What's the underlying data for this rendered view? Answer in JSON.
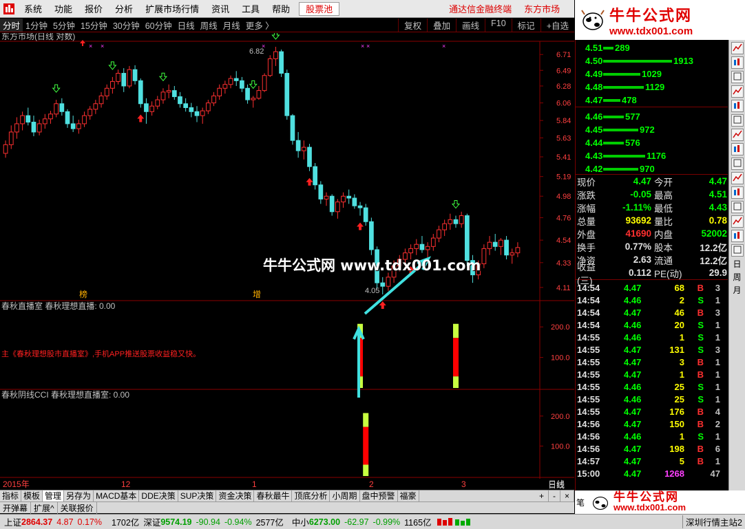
{
  "menu": {
    "items": [
      "系统",
      "功能",
      "报价",
      "分析",
      "扩展市场行情",
      "资讯",
      "工具",
      "帮助"
    ],
    "stock_pool": "股票池",
    "promo1": "通达信金融终端",
    "promo2": "东方市场"
  },
  "period_bar": {
    "periods": [
      "分时",
      "1分钟",
      "5分钟",
      "15分钟",
      "30分钟",
      "60分钟",
      "日线",
      "周线",
      "月线",
      "更多 〉"
    ],
    "active": "分时",
    "right_buttons": [
      "复权",
      "叠加",
      "画线",
      "F10",
      "标记",
      "+自选"
    ]
  },
  "chart": {
    "title": "东方市场(日线 对数)",
    "price_ticks": [
      "6.71",
      "6.49",
      "6.28",
      "6.06",
      "5.84",
      "5.63",
      "5.41",
      "5.19",
      "4.98",
      "4.76",
      "4.54",
      "4.33",
      "4.11"
    ],
    "high_label": "6.82",
    "low_label": "4.05",
    "tag1": "榜",
    "tag2": "增",
    "indicator1_title": "春秋直播室 春秋理想直播: 0.00",
    "indicator1_ticks": [
      "200.0",
      "100.0"
    ],
    "indicator1_text": "主《春秋理想股市直播室》,手机APP推送股票收益稳又快。",
    "indicator2_title": "春秋阴线CCI 春秋理想直播室: 0.00",
    "indicator2_ticks": [
      "200.0",
      "100.0"
    ],
    "date_labels": [
      "2015年",
      "12",
      "1",
      "2",
      "3"
    ],
    "period_label": "日线",
    "watermark": "牛牛公式网 www.tdx001.com"
  },
  "chart_data": {
    "type": "candlestick",
    "title": "东方市场(日线 对数)",
    "ylim": [
      4.05,
      6.82
    ],
    "ohlc": [
      [
        5.45,
        5.6,
        5.4,
        5.55
      ],
      [
        5.55,
        5.78,
        5.5,
        5.7
      ],
      [
        5.7,
        5.88,
        5.62,
        5.8
      ],
      [
        5.8,
        5.95,
        5.72,
        5.9
      ],
      [
        5.9,
        6.0,
        5.78,
        5.82
      ],
      [
        5.82,
        5.9,
        5.65,
        5.7
      ],
      [
        5.7,
        5.85,
        5.66,
        5.8
      ],
      [
        5.8,
        5.92,
        5.74,
        5.86
      ],
      [
        5.86,
        5.96,
        5.8,
        5.92
      ],
      [
        5.92,
        6.1,
        5.88,
        6.05
      ],
      [
        6.05,
        6.12,
        5.9,
        5.95
      ],
      [
        5.95,
        5.98,
        5.75,
        5.8
      ],
      [
        5.8,
        5.9,
        5.7,
        5.74
      ],
      [
        5.74,
        5.85,
        5.68,
        5.8
      ],
      [
        5.8,
        5.95,
        5.76,
        5.9
      ],
      [
        5.9,
        6.02,
        5.85,
        5.98
      ],
      [
        5.98,
        6.1,
        5.92,
        6.05
      ],
      [
        6.05,
        6.2,
        6.0,
        6.15
      ],
      [
        6.15,
        6.3,
        6.1,
        6.25
      ],
      [
        6.25,
        6.4,
        6.18,
        6.34
      ],
      [
        6.34,
        6.5,
        6.3,
        6.45
      ],
      [
        6.45,
        6.52,
        6.2,
        6.28
      ],
      [
        6.28,
        6.55,
        6.25,
        6.5
      ],
      [
        6.5,
        6.56,
        6.3,
        6.35
      ],
      [
        6.35,
        6.38,
        6.0,
        6.05
      ],
      [
        6.05,
        6.12,
        5.8,
        5.95
      ],
      [
        5.95,
        6.08,
        5.9,
        6.02
      ],
      [
        6.02,
        6.15,
        5.98,
        6.1
      ],
      [
        6.1,
        6.25,
        6.05,
        6.2
      ],
      [
        6.2,
        6.3,
        6.12,
        6.22
      ],
      [
        6.22,
        6.28,
        6.1,
        6.14
      ],
      [
        6.14,
        6.2,
        6.0,
        6.05
      ],
      [
        6.05,
        6.12,
        5.95,
        6.0
      ],
      [
        6.0,
        6.06,
        5.88,
        5.95
      ],
      [
        5.95,
        6.02,
        5.82,
        5.9
      ],
      [
        5.9,
        6.0,
        5.8,
        5.96
      ],
      [
        5.96,
        6.1,
        5.92,
        6.06
      ],
      [
        6.06,
        6.2,
        6.02,
        6.15
      ],
      [
        6.15,
        6.3,
        6.1,
        6.25
      ],
      [
        6.25,
        6.35,
        6.18,
        6.3
      ],
      [
        6.3,
        6.42,
        6.25,
        6.38
      ],
      [
        6.38,
        6.48,
        6.28,
        6.35
      ],
      [
        6.35,
        6.4,
        6.2,
        6.25
      ],
      [
        6.25,
        6.3,
        6.05,
        6.1
      ],
      [
        6.1,
        6.15,
        6.0,
        6.12
      ],
      [
        6.12,
        6.28,
        6.1,
        6.22
      ],
      [
        6.22,
        6.45,
        6.2,
        6.42
      ],
      [
        6.42,
        6.7,
        6.4,
        6.65
      ],
      [
        6.65,
        6.82,
        6.55,
        6.75
      ],
      [
        6.75,
        6.78,
        6.4,
        6.45
      ],
      [
        6.45,
        6.5,
        5.85,
        5.9
      ],
      [
        5.9,
        5.92,
        5.55,
        5.6
      ],
      [
        5.6,
        5.7,
        5.4,
        5.48
      ],
      [
        5.48,
        5.6,
        5.38,
        5.52
      ],
      [
        5.52,
        5.56,
        5.25,
        5.3
      ],
      [
        5.3,
        5.34,
        5.05,
        5.1
      ],
      [
        5.1,
        5.14,
        4.9,
        4.95
      ],
      [
        4.95,
        5.02,
        4.88,
        4.98
      ],
      [
        4.98,
        5.0,
        4.78,
        4.82
      ],
      [
        4.82,
        4.95,
        4.75,
        4.92
      ],
      [
        4.92,
        5.02,
        4.86,
        4.98
      ],
      [
        4.98,
        5.05,
        4.9,
        4.96
      ],
      [
        4.96,
        5.0,
        4.85,
        4.88
      ],
      [
        4.88,
        4.92,
        4.78,
        4.86
      ],
      [
        4.86,
        4.9,
        4.68,
        4.72
      ],
      [
        4.72,
        4.76,
        4.4,
        4.45
      ],
      [
        4.45,
        4.48,
        4.1,
        4.15
      ],
      [
        4.15,
        4.2,
        4.05,
        4.12
      ],
      [
        4.12,
        4.24,
        4.08,
        4.2
      ],
      [
        4.2,
        4.35,
        4.15,
        4.3
      ],
      [
        4.3,
        4.4,
        4.25,
        4.36
      ],
      [
        4.36,
        4.46,
        4.3,
        4.42
      ],
      [
        4.42,
        4.5,
        4.36,
        4.46
      ],
      [
        4.46,
        4.55,
        4.4,
        4.5
      ],
      [
        4.5,
        4.58,
        4.42,
        4.45
      ],
      [
        4.45,
        4.52,
        4.38,
        4.48
      ],
      [
        4.48,
        4.6,
        4.44,
        4.56
      ],
      [
        4.56,
        4.68,
        4.52,
        4.64
      ],
      [
        4.64,
        4.74,
        4.58,
        4.7
      ],
      [
        4.7,
        4.8,
        4.64,
        4.74
      ],
      [
        4.74,
        4.78,
        4.66,
        4.7
      ],
      [
        4.7,
        4.82,
        4.66,
        4.78
      ],
      [
        4.78,
        4.8,
        4.3,
        4.35
      ],
      [
        4.35,
        4.4,
        4.15,
        4.22
      ],
      [
        4.22,
        4.35,
        4.18,
        4.32
      ],
      [
        4.32,
        4.5,
        4.28,
        4.46
      ],
      [
        4.46,
        4.58,
        4.4,
        4.52
      ],
      [
        4.52,
        4.6,
        4.44,
        4.48
      ],
      [
        4.48,
        4.56,
        4.4,
        4.54
      ],
      [
        4.54,
        4.58,
        4.36,
        4.4
      ],
      [
        4.4,
        4.46,
        4.32,
        4.42
      ],
      [
        4.42,
        4.52,
        4.38,
        4.47
      ]
    ],
    "arrows_up_index": [
      24,
      54,
      63,
      67,
      72
    ],
    "arrows_down_index": [
      9,
      19,
      28,
      44,
      48,
      80
    ],
    "indicator1_bars": [
      {
        "index": 63,
        "value": 210
      },
      {
        "index": 80,
        "value": 210
      }
    ],
    "indicator2_bars": [
      {
        "index": 64,
        "value": 210
      }
    ],
    "indicator_ylim": [
      0,
      250
    ],
    "xlabels": [
      "2015年",
      "12",
      "1",
      "2",
      "3"
    ]
  },
  "order_book": {
    "asks": [
      {
        "price": "4.51",
        "vol": 289
      },
      {
        "price": "4.50",
        "vol": 1913
      },
      {
        "price": "4.49",
        "vol": 1029
      },
      {
        "price": "4.48",
        "vol": 1129
      },
      {
        "price": "4.47",
        "vol": 478
      }
    ],
    "bids": [
      {
        "price": "4.46",
        "vol": 577
      },
      {
        "price": "4.45",
        "vol": 972
      },
      {
        "price": "4.44",
        "vol": 576
      },
      {
        "price": "4.43",
        "vol": 1176
      },
      {
        "price": "4.42",
        "vol": 970
      }
    ]
  },
  "quote": [
    {
      "l": "现价",
      "v": "4.47",
      "vc": "gfg",
      "l2": "今开",
      "v2": "4.47",
      "v2c": "gfg"
    },
    {
      "l": "涨跌",
      "v": "-0.05",
      "vc": "gfg",
      "l2": "最高",
      "v2": "4.51",
      "v2c": "gfg"
    },
    {
      "l": "涨幅",
      "v": "-1.11%",
      "vc": "gfg",
      "l2": "最低",
      "v2": "4.43",
      "v2c": "gfg"
    },
    {
      "l": "总量",
      "v": "93692",
      "vc": "yfg",
      "l2": "量比",
      "v2": "0.78",
      "v2c": "yfg"
    },
    {
      "l": "外盘",
      "v": "41690",
      "vc": "rfg",
      "l2": "内盘",
      "v2": "52002",
      "v2c": "gfg"
    },
    {
      "l": "换手",
      "v": "0.77%",
      "vc": "wfg",
      "l2": "股本",
      "v2": "12.2亿",
      "v2c": "wfg"
    },
    {
      "l": "净资",
      "v": "2.63",
      "vc": "wfg",
      "l2": "流通",
      "v2": "12.2亿",
      "v2c": "wfg"
    },
    {
      "l": "收益(三)",
      "v": "0.112",
      "vc": "wfg",
      "l2": "PE(动)",
      "v2": "29.9",
      "v2c": "wfg"
    }
  ],
  "ticks": [
    {
      "t": "14:54",
      "p": "4.47",
      "v": "68",
      "d": "B",
      "n": "3"
    },
    {
      "t": "14:54",
      "p": "4.46",
      "v": "2",
      "d": "S",
      "n": "1"
    },
    {
      "t": "14:54",
      "p": "4.47",
      "v": "46",
      "d": "B",
      "n": "3"
    },
    {
      "t": "14:54",
      "p": "4.46",
      "v": "20",
      "d": "S",
      "n": "1"
    },
    {
      "t": "14:55",
      "p": "4.46",
      "v": "1",
      "d": "S",
      "n": "1"
    },
    {
      "t": "14:55",
      "p": "4.47",
      "v": "131",
      "d": "S",
      "n": "3"
    },
    {
      "t": "14:55",
      "p": "4.47",
      "v": "3",
      "d": "B",
      "n": "1"
    },
    {
      "t": "14:55",
      "p": "4.47",
      "v": "1",
      "d": "B",
      "n": "1"
    },
    {
      "t": "14:55",
      "p": "4.46",
      "v": "25",
      "d": "S",
      "n": "1"
    },
    {
      "t": "14:55",
      "p": "4.46",
      "v": "25",
      "d": "S",
      "n": "1"
    },
    {
      "t": "14:55",
      "p": "4.47",
      "v": "176",
      "d": "B",
      "n": "4"
    },
    {
      "t": "14:56",
      "p": "4.47",
      "v": "150",
      "d": "B",
      "n": "2"
    },
    {
      "t": "14:56",
      "p": "4.46",
      "v": "1",
      "d": "S",
      "n": "1"
    },
    {
      "t": "14:56",
      "p": "4.47",
      "v": "198",
      "d": "B",
      "n": "6"
    },
    {
      "t": "14:57",
      "p": "4.47",
      "v": "5",
      "d": "B",
      "n": "1"
    },
    {
      "t": "15:00",
      "p": "4.47",
      "v": "1268",
      "d": "",
      "n": "47"
    }
  ],
  "sidebar": {
    "icons": [
      "chart-icon",
      "candle-icon",
      "bar-icon",
      "line-icon",
      "table-icon",
      "news-icon",
      "grid-icon",
      "f10-icon",
      "rsi-icon",
      "info-icon",
      "nav-icon",
      "up-icon",
      "down-icon",
      "plus-icon",
      "minus-icon"
    ],
    "texts": [
      "日",
      "周",
      "月"
    ]
  },
  "tabs": [
    "指标",
    "模板",
    "管理",
    "另存为",
    "MACD基本",
    "DDE决策",
    "SUP决策",
    "资金决策",
    "春秋最牛",
    "顶底分析",
    "小周期",
    "盘中预警",
    "福豪"
  ],
  "active_tab": "管理",
  "tab_controls": [
    "+",
    "-",
    "×"
  ],
  "subtabs": [
    "开弹幕",
    "扩展^",
    "关联报价"
  ],
  "status": {
    "sh_label": "上证",
    "sh_val": "2864.37",
    "sh_chg": "4.87",
    "sh_pct": "0.17%",
    "sh_amt": "1702亿",
    "sz_label": "深证",
    "sz_val": "9574.19",
    "sz_chg": "-90.94",
    "sz_pct": "-0.94%",
    "sz_amt": "2577亿",
    "zx_label": "中小",
    "zx_val": "6273.00",
    "zx_chg": "-62.97",
    "zx_pct": "-0.99%",
    "zx_amt": "1165亿",
    "server": "深圳行情主站2"
  },
  "brand": {
    "title": "牛牛公式网",
    "url": "www.tdx001.com"
  },
  "colors": {
    "up": "#ff3030",
    "down": "#50e0e0",
    "bg": "#000000",
    "axis": "#8b0000"
  }
}
